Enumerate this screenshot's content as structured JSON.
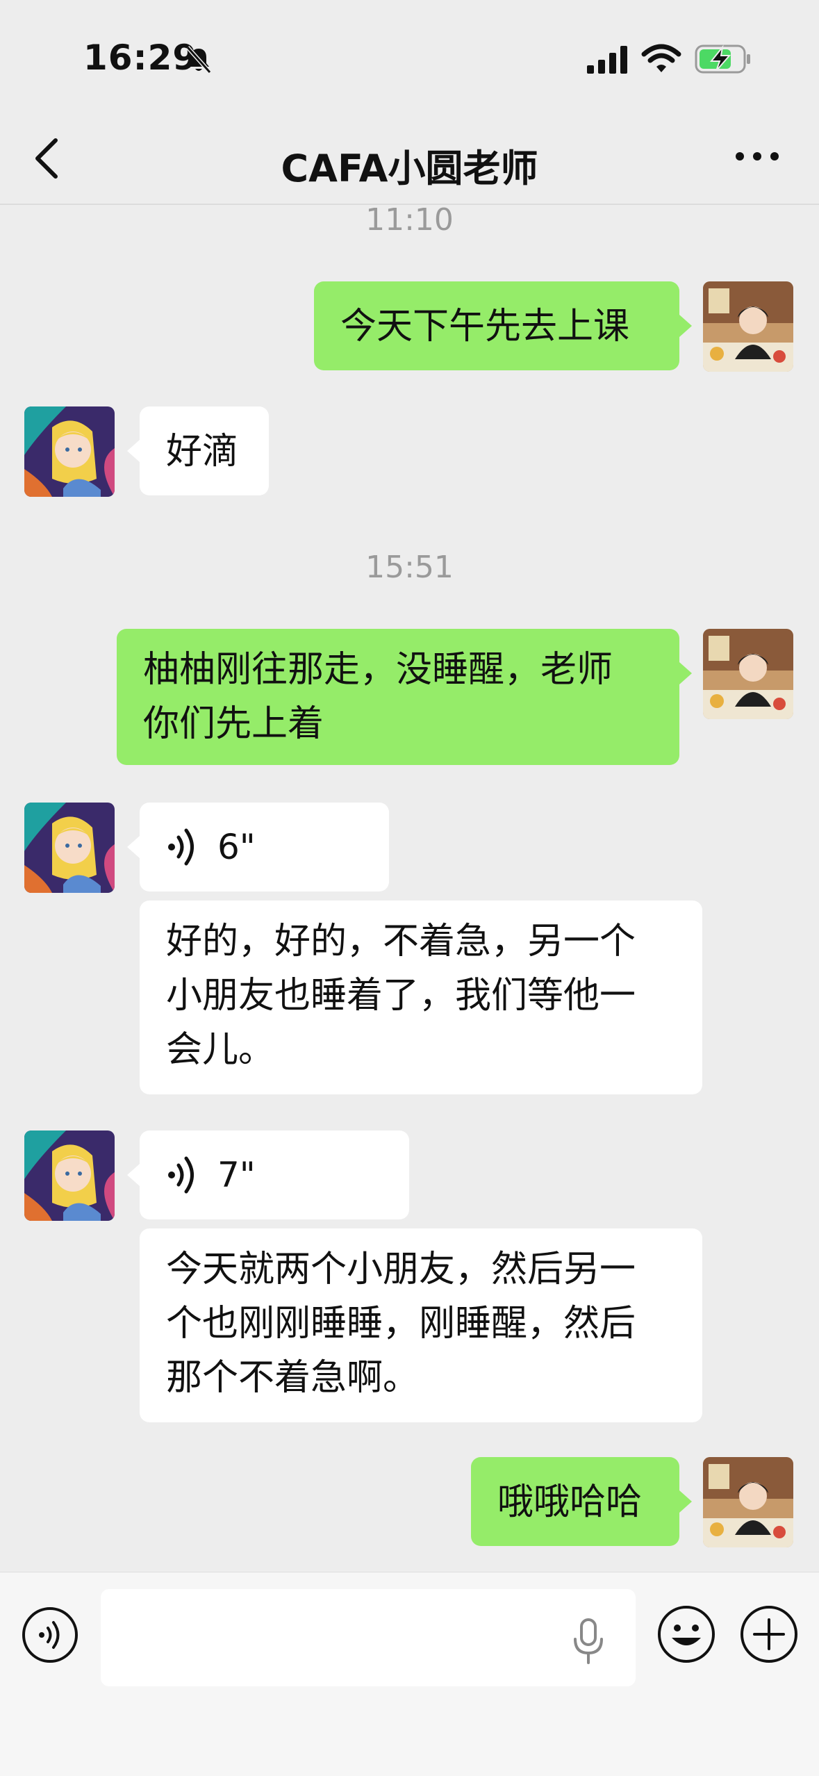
{
  "status_bar": {
    "time": "16:29",
    "icons": [
      "mute-bell-icon",
      "signal-icon",
      "wifi-icon",
      "battery-charging-icon"
    ]
  },
  "nav": {
    "title": "CAFA小圆老师",
    "back_icon": "chevron-left-icon",
    "more_icon": "more-icon"
  },
  "messages": {
    "time_1": "11:10",
    "m1": "今天下午先去上课",
    "m2": "好滴",
    "time_2": "15:51",
    "m3_line1": "柚柚刚往那走，没睡醒，老师",
    "m3_line2": "你们先上着",
    "voice1_duration": "6\"",
    "m4_line1": "好的，好的，不着急，另一个",
    "m4_line2": "小朋友也睡着了，我们等他一",
    "m4_line3": "会儿。",
    "voice2_duration": "7\"",
    "m5_line1": "今天就两个小朋友，然后另一",
    "m5_line2": "个也刚刚睡睡，刚睡醒，然后",
    "m5_line3": "那个不着急啊。",
    "m6": "哦哦哈哈"
  },
  "input": {
    "placeholder": "",
    "icons": [
      "voice-toggle-icon",
      "microphone-icon",
      "emoji-icon",
      "plus-icon"
    ]
  },
  "colors": {
    "background": "#ededed",
    "my_bubble": "#95ec69",
    "other_bubble": "#ffffff",
    "time_text": "#9a9a9a"
  }
}
